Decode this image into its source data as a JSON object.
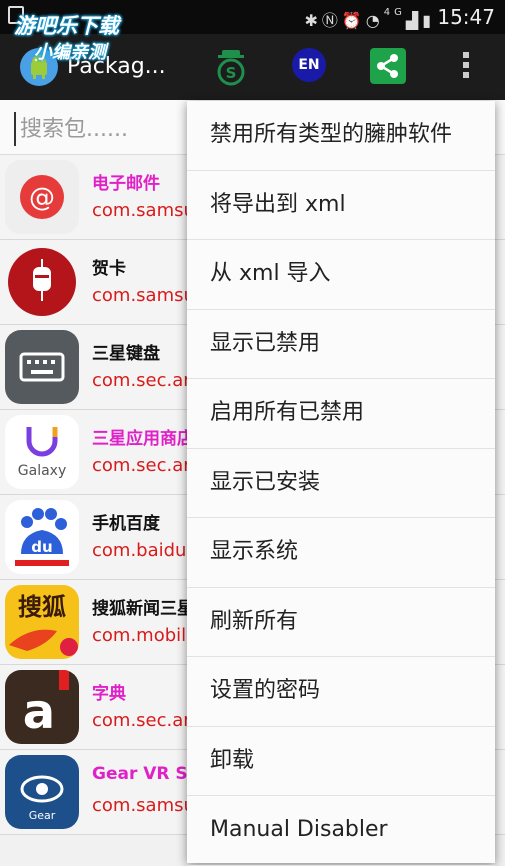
{
  "status_bar": {
    "icons": [
      "bluetooth-icon",
      "nfc-icon",
      "alarm-icon",
      "wifi-icon",
      "4g-icon",
      "signal-icon",
      "battery-icon"
    ],
    "network_label": "4G",
    "time": "15:47"
  },
  "watermark": {
    "line1": "游吧乐下载",
    "line2": "小编亲测"
  },
  "app_bar": {
    "title": "Packag...",
    "en_label": "EN"
  },
  "search": {
    "placeholder": "搜索包......"
  },
  "apps": [
    {
      "name": "电子邮件",
      "package": "com.samsu",
      "name_color": "#e020c8",
      "icon": "email-icon"
    },
    {
      "name": "贺卡",
      "package": "com.samsu",
      "name_color": "#111111",
      "icon": "greeting-card-icon"
    },
    {
      "name": "三星键盘",
      "package": "com.sec.ar",
      "name_color": "#111111",
      "icon": "keyboard-icon"
    },
    {
      "name": "三星应用商店",
      "package": "com.sec.ar",
      "name_color": "#e020c8",
      "icon": "galaxy-apps-icon",
      "icon_text": "Galaxy"
    },
    {
      "name": "手机百度",
      "package": "com.baidu.",
      "name_color": "#111111",
      "icon": "baidu-icon",
      "icon_text": "du"
    },
    {
      "name": "搜狐新闻三星",
      "package": "com.mobile",
      "name_color": "#111111",
      "icon": "sohu-news-icon",
      "icon_text": "搜狐"
    },
    {
      "name": "字典",
      "package": "com.sec.ar",
      "name_color": "#e020c8",
      "icon": "dictionary-icon",
      "icon_text": "a"
    },
    {
      "name": "Gear VR Se",
      "package": "com.samsu",
      "name_color": "#e020c8",
      "icon": "gear-vr-icon",
      "icon_text": "Gear"
    }
  ],
  "menu": {
    "items": [
      "禁用所有类型的臃肿软件",
      "将导出到 xml",
      "从 xml 导入",
      "显示已禁用",
      "启用所有已禁用",
      "显示已安装",
      "显示系统",
      "刷新所有",
      "设置的密码",
      "卸载",
      "Manual Disabler"
    ]
  },
  "colors": {
    "app_bar": "#1c1c1c",
    "package_text": "#d81b1b",
    "accent_pink": "#e020c8",
    "share_green": "#1ea24a"
  }
}
